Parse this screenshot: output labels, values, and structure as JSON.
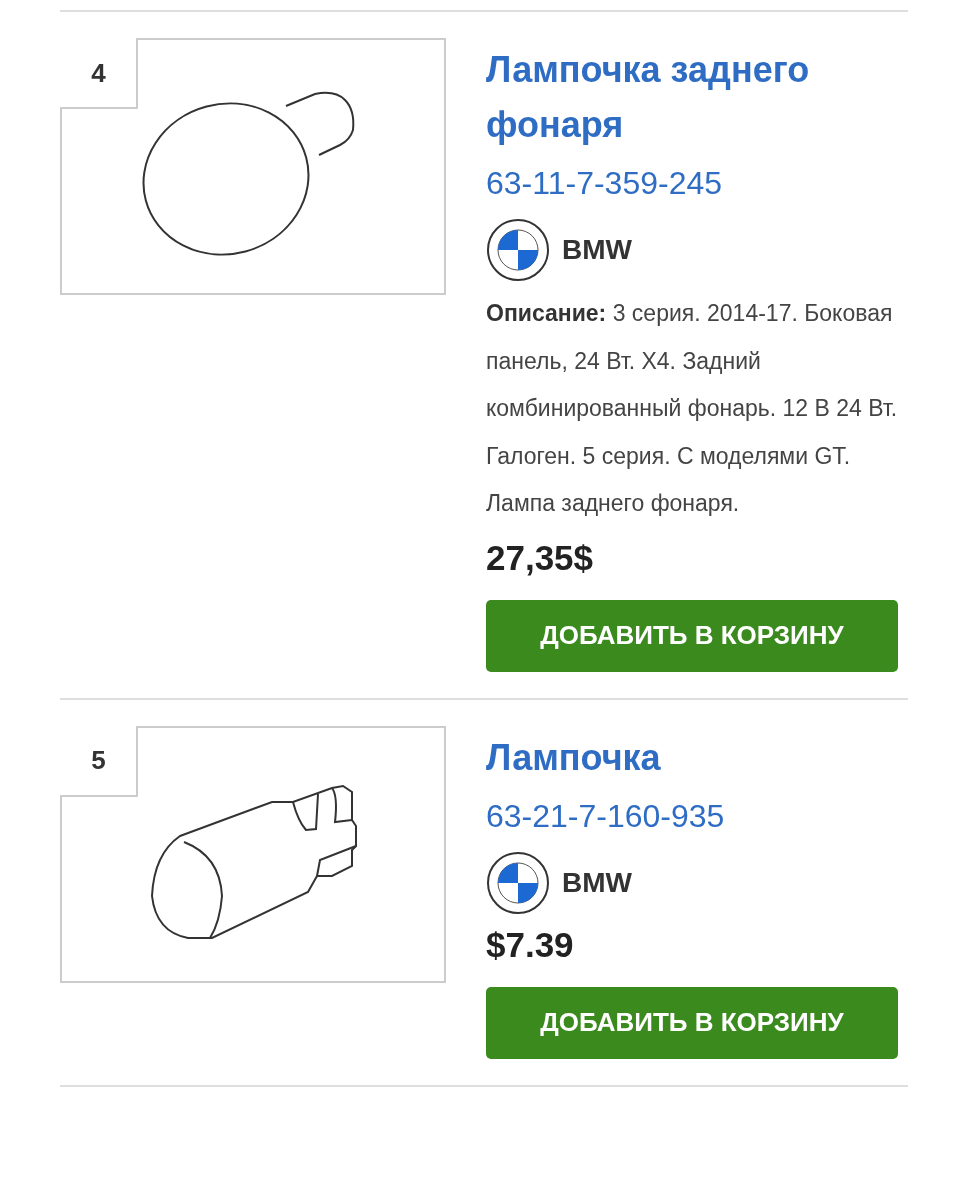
{
  "parts": [
    {
      "number": "4",
      "kind": "round-bulb",
      "title": "Лампочка заднего фонаря",
      "part_number": "63-11-7-359-245",
      "brand": "BMW",
      "description": "**Описание:** 3 серия. 2014-17. Боковая панель, 24 Вт. X4. Задний комбинированный фонарь. 12 В 24 Вт. Галоген. 5 серия. С моделями GT. Лампа заднего фонаря.",
      "price": "27,35$",
      "button": "ДОБАВИТЬ В КОРЗИНУ"
    },
    {
      "number": "5",
      "kind": "wedge-bulb",
      "title": "Лампочка",
      "part_number": "63-21-7-160-935",
      "brand": "BMW",
      "price": "$7.39",
      "button": "ДОБАВИТЬ В КОРЗИНУ"
    }
  ]
}
